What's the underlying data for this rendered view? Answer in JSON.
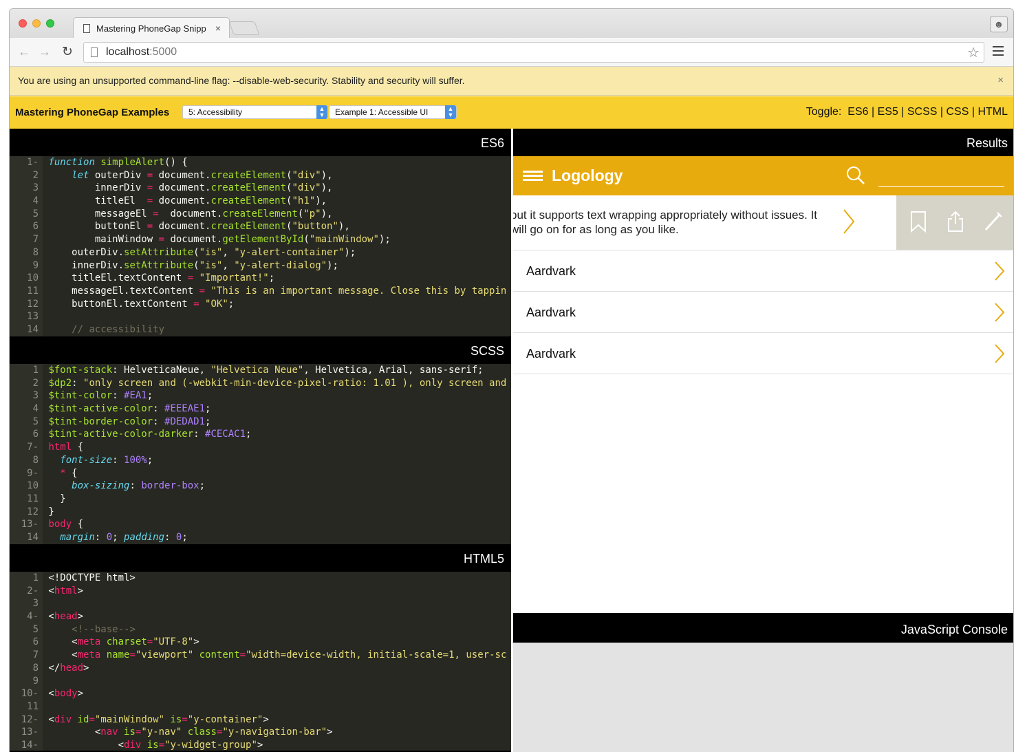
{
  "browser": {
    "tab_title": "Mastering PhoneGap Snipp",
    "tab_close": "×",
    "url_host": "localhost",
    "url_port": ":5000",
    "warning": "You are using an unsupported command-line flag: --disable-web-security. Stability and security will suffer.",
    "warning_close": "×"
  },
  "app": {
    "brand": "Mastering PhoneGap Examples",
    "chapter_select": "5: Accessibility",
    "example_select": "Example 1: Accessible UI",
    "toggle_label": "Toggle:",
    "toggles": [
      "ES6",
      "ES5",
      "SCSS",
      "CSS",
      "HTML"
    ]
  },
  "panels": {
    "es6": "ES6",
    "scss": "SCSS",
    "html": "HTML5",
    "results": "Results",
    "console": "JavaScript Console"
  },
  "results": {
    "app_title": "Logology",
    "swipe_text": "but it supports text wrapping appropriately without issues. It will go on for as long as you like.",
    "items": [
      "Aardvark",
      "Aardvark",
      "Aardvark"
    ]
  },
  "icons": {
    "hamburger": "menu-icon",
    "search": "search-icon",
    "bookmark": "bookmark-icon",
    "share": "share-icon",
    "edit": "pencil-icon"
  }
}
